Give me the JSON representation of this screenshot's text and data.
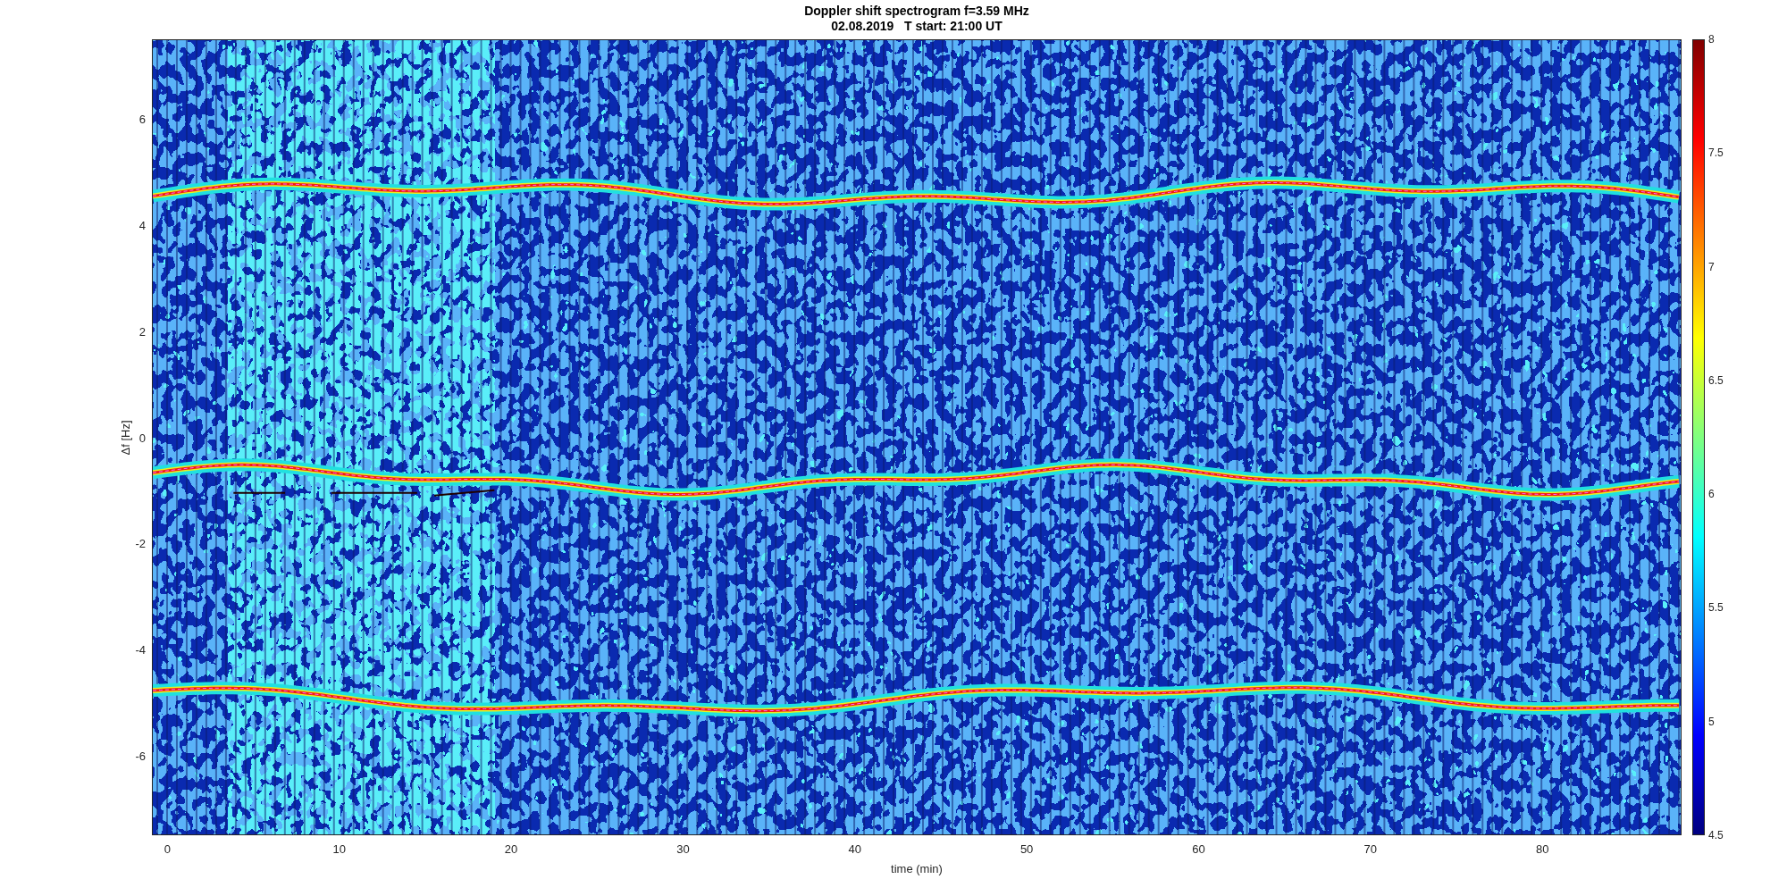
{
  "figure": {
    "title_lines": [
      "Doppler shift spectrogram f=3.59 MHz",
      "02.08.2019   T start: 21:00 UT"
    ]
  },
  "x_axis": {
    "label": "time (min)",
    "ticks": [
      "0",
      "10",
      "20",
      "30",
      "40",
      "50",
      "60",
      "70",
      "80"
    ]
  },
  "y_axis": {
    "label": "Δf [Hz]",
    "ticks": [
      "6",
      "4",
      "2",
      "0",
      "-2",
      "-4",
      "-6"
    ]
  },
  "colorbar": {
    "ticks": [
      "8",
      "7.5",
      "7",
      "6.5",
      "6",
      "5.5",
      "5",
      "4.5"
    ]
  }
}
